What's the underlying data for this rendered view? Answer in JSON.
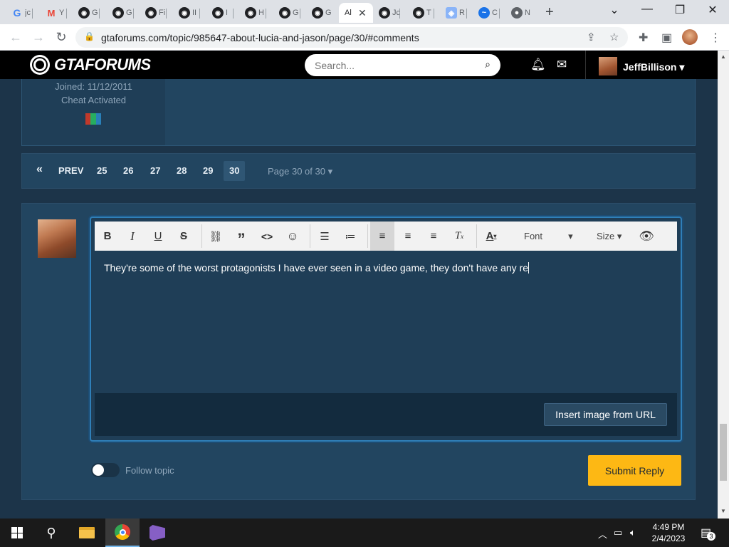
{
  "browser": {
    "tabs": [
      {
        "favicon": "google-g",
        "title": "jc"
      },
      {
        "favicon": "gmail-m",
        "title": "Y"
      },
      {
        "favicon": "gtaforums",
        "title": "G"
      },
      {
        "favicon": "gtaforums",
        "title": "G"
      },
      {
        "favicon": "gtaforums",
        "title": "Fi"
      },
      {
        "favicon": "gtaforums",
        "title": "II"
      },
      {
        "favicon": "gtaforums",
        "title": "I"
      },
      {
        "favicon": "gtaforums",
        "title": "H"
      },
      {
        "favicon": "gtaforums",
        "title": "G"
      },
      {
        "favicon": "gtaforums",
        "title": "G"
      },
      {
        "favicon": "none",
        "title": "Al",
        "active": true
      },
      {
        "favicon": "gtaforums",
        "title": "Jc"
      },
      {
        "favicon": "gtaforums",
        "title": "T"
      },
      {
        "favicon": "shield",
        "title": "R"
      },
      {
        "favicon": "edge-blue",
        "title": "C"
      },
      {
        "favicon": "gray-circle",
        "title": "N"
      }
    ],
    "url": "gtaforums.com/topic/985647-about-lucia-and-jason/page/30/#comments"
  },
  "site": {
    "logo": "GTAFORUMS",
    "search_placeholder": "Search...",
    "username": "JeffBillison"
  },
  "author": {
    "joined": "Joined: 11/12/2011",
    "rank": "Cheat Activated"
  },
  "pagination": {
    "first": "«",
    "prev": "PREV",
    "pages": [
      "25",
      "26",
      "27",
      "28",
      "29",
      "30"
    ],
    "current": "30",
    "info": "Page 30 of 30"
  },
  "editor": {
    "font_dropdown": "Font",
    "size_dropdown": "Size",
    "text": "They're some of the worst protagonists I have ever seen in a video game, they don't have any re",
    "insert_image": "Insert image from URL"
  },
  "reply": {
    "follow_label": "Follow topic",
    "follow_on": false,
    "submit": "Submit Reply"
  },
  "taskbar": {
    "time": "4:49 PM",
    "date": "2/4/2023",
    "notifications": "3"
  },
  "colors": {
    "accent_yellow": "#fdb814",
    "panel_blue": "#224560",
    "page_bg": "#1c3449",
    "editor_border": "#2f7fb8"
  }
}
